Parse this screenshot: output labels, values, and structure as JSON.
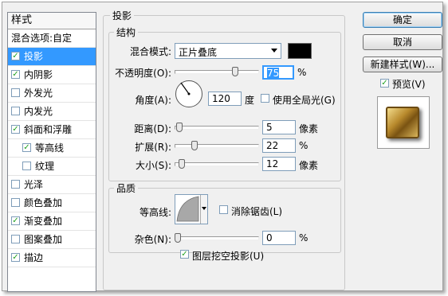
{
  "styles_panel": {
    "header": "样式",
    "blend_options": "混合选项:自定",
    "items": [
      {
        "label": "投影",
        "checked": true,
        "selected": true,
        "indent": false
      },
      {
        "label": "内阴影",
        "checked": true,
        "selected": false,
        "indent": false
      },
      {
        "label": "外发光",
        "checked": false,
        "selected": false,
        "indent": false
      },
      {
        "label": "内发光",
        "checked": false,
        "selected": false,
        "indent": false
      },
      {
        "label": "斜面和浮雕",
        "checked": true,
        "selected": false,
        "indent": false
      },
      {
        "label": "等高线",
        "checked": true,
        "selected": false,
        "indent": true
      },
      {
        "label": "纹理",
        "checked": false,
        "selected": false,
        "indent": true
      },
      {
        "label": "光泽",
        "checked": false,
        "selected": false,
        "indent": false
      },
      {
        "label": "颜色叠加",
        "checked": false,
        "selected": false,
        "indent": false
      },
      {
        "label": "渐变叠加",
        "checked": true,
        "selected": false,
        "indent": false
      },
      {
        "label": "图案叠加",
        "checked": false,
        "selected": false,
        "indent": false
      },
      {
        "label": "描边",
        "checked": true,
        "selected": false,
        "indent": false
      }
    ]
  },
  "drop_shadow": {
    "title": "投影",
    "structure": {
      "title": "结构",
      "blend_mode_label": "混合模式:",
      "blend_mode_value": "正片叠底",
      "shadow_color": "#000000",
      "opacity_label": "不透明度(O):",
      "opacity_value": "75",
      "opacity_level": 0.75,
      "percent": "%",
      "angle_label": "角度(A):",
      "angle_value": "120",
      "angle_unit": "度",
      "global_light_label": "使用全局光(G)",
      "global_light_checked": false,
      "distance_label": "距离(D):",
      "distance_value": "5",
      "distance_level": 0.02,
      "spread_label": "扩展(R):",
      "spread_value": "22",
      "spread_level": 0.22,
      "size_label": "大小(S):",
      "size_value": "12",
      "size_level": 0.05,
      "pixel_unit": "像素"
    },
    "quality": {
      "title": "品质",
      "contour_label": "等高线:",
      "anti_alias_label": "消除锯齿(L)",
      "anti_alias_checked": false,
      "noise_label": "杂色(N):",
      "noise_value": "0",
      "noise_level": 0,
      "percent": "%"
    },
    "knockout_label": "图层挖空投影(U)",
    "knockout_checked": true
  },
  "buttons": {
    "ok": "确定",
    "cancel": "取消",
    "new_style": "新建样式(W)...",
    "preview_label": "预览(V)",
    "preview_checked": true
  }
}
